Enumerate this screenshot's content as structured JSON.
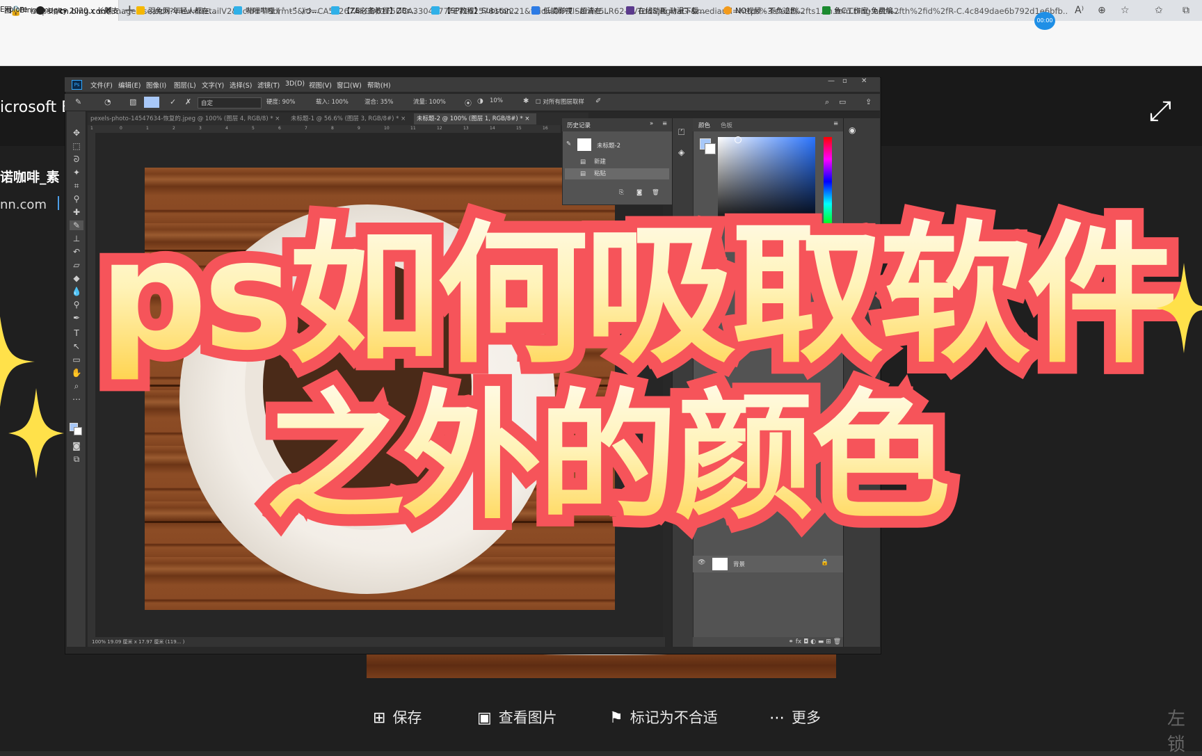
{
  "browser": {
    "tab_title": "图 - Bing images",
    "tab_close": "✕",
    "new_tab": "+",
    "url_prefix": "https://",
    "url_host": "cn.bing.com",
    "url_rest": "/images/search?view=detailV2&ccid=TlSdrmt5&id=CA57267AFCD61F5DCA3304977FE7162578162221&thid=OIP.TlSdrmt5LR62-7VTddSjRgHaG-&mediaurl=https%3a%2f%2fts1.cn.mm.bing.net%2fth%2fid%2fR-C.4c849dae6b792d1e6bfb...",
    "timer": "00:00",
    "bookmarks": [
      "Explore",
      "Unity 2020.x 长期支...",
      "羽兔网-年轻人都在...",
      "哔哩哔哩 ( ゜- ゜)つ...",
      "【ZB必备教程】ZBr...",
      "【SP教程】Substan...",
      "低調影視 - 超清在...",
      "在线动画 动漫下载...",
      "NO视频 - 不负追剧...",
      "鱼C工作室-免费编..."
    ]
  },
  "page": {
    "logo_text": "icrosoft B",
    "side_title": "诺咖啡_素",
    "side_url": "nn.com",
    "expand_icon": "⤢"
  },
  "photoshop": {
    "logo": "Ps",
    "menu": [
      "文件(F)",
      "编辑(E)",
      "图像(I)",
      "图层(L)",
      "文字(Y)",
      "选择(S)",
      "滤镜(T)",
      "3D(D)",
      "视图(V)",
      "窗口(W)",
      "帮助(H)"
    ],
    "options": {
      "preset": "自定",
      "size": "硬度: 90%",
      "load": "载入: 100%",
      "mix": "混合: 35%",
      "flow": "流量: 100%",
      "angle": "10%",
      "sample_all": "对所有图层取样"
    },
    "doc_tabs": [
      "pexels-photo-14547634-恢复的.jpeg @ 100% (图层 4, RGB/8) *",
      "未标题-1 @ 56.6% (图层 3, RGB/8#) *",
      "未标题-2 @ 100% (图层 1, RGB/8#) *"
    ],
    "ruler": [
      "1",
      "0",
      "1",
      "2",
      "3",
      "4",
      "5",
      "6",
      "7",
      "8",
      "9",
      "10",
      "11",
      "12",
      "13",
      "14",
      "15",
      "16"
    ],
    "status": "100%    19.09 厘米 x 17.97 厘米 (119... )",
    "history": {
      "title": "历史记录",
      "doc": "未标题-2",
      "items": [
        "新建",
        "粘贴"
      ]
    },
    "color_panel": {
      "tabs": [
        "颜色",
        "色板"
      ]
    },
    "layer": {
      "name": "背景"
    }
  },
  "overlay": {
    "line1": "ps如何吸取软件",
    "line2": "之外的颜色"
  },
  "actions": {
    "save": "保存",
    "view": "查看图片",
    "flag": "标记为不合适",
    "more": "更多"
  },
  "watermark": "左锁",
  "colors": {
    "headline_stroke": "#f6545a",
    "headline_fill_top": "#fffbea",
    "headline_fill_bottom": "#ffd24a",
    "sparkle": "#ffe14a",
    "foreground_swatch": "#a8c8f8"
  }
}
